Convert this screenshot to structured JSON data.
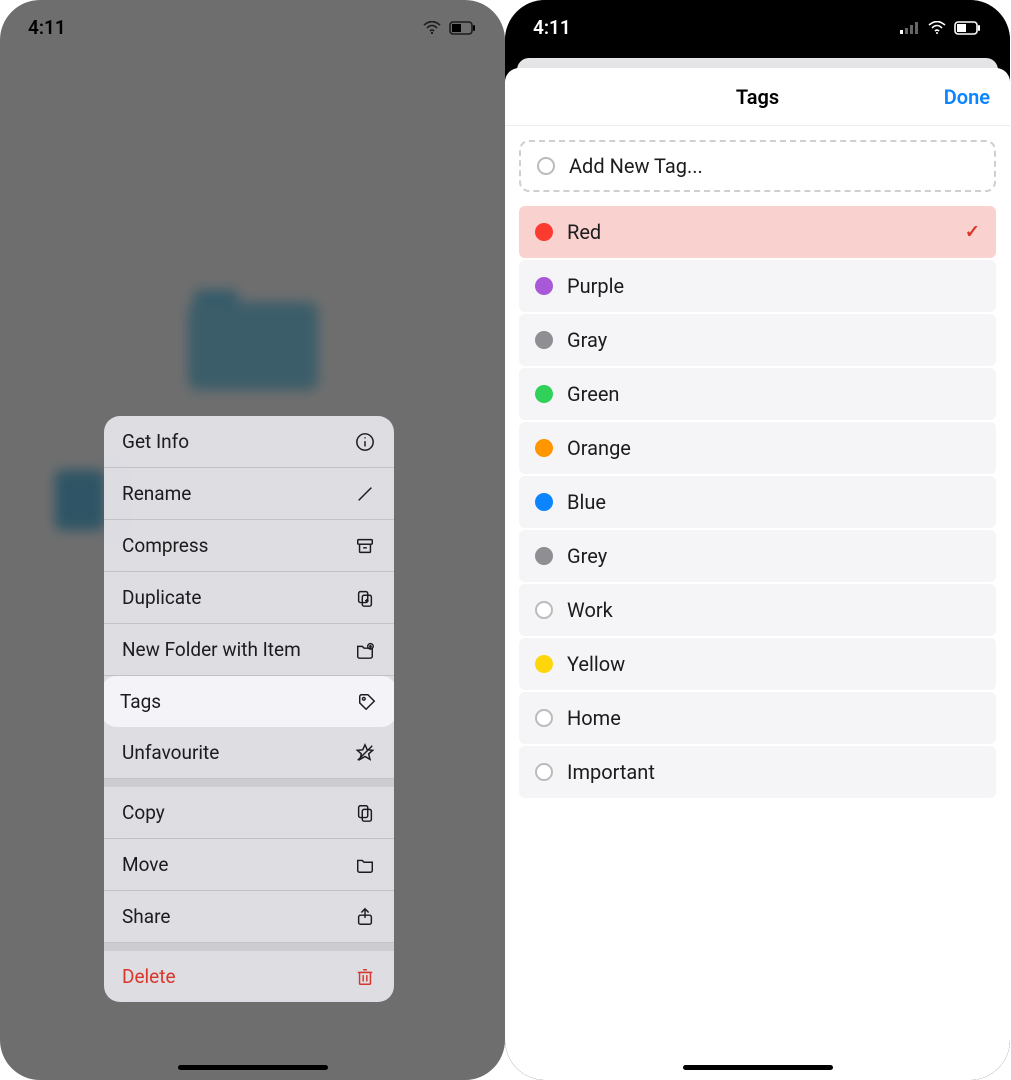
{
  "status": {
    "time": "4:11"
  },
  "context_menu": {
    "items": [
      {
        "label": "Get Info",
        "icon": "info"
      },
      {
        "label": "Rename",
        "icon": "pencil"
      },
      {
        "label": "Compress",
        "icon": "archive"
      },
      {
        "label": "Duplicate",
        "icon": "duplicate"
      },
      {
        "label": "New Folder with Item",
        "icon": "new-folder"
      },
      {
        "label": "Tags",
        "icon": "tag",
        "highlight": true
      },
      {
        "label": "Unfavourite",
        "icon": "star-slash"
      },
      {
        "label": "Copy",
        "icon": "copy"
      },
      {
        "label": "Move",
        "icon": "folder"
      },
      {
        "label": "Share",
        "icon": "share"
      },
      {
        "label": "Delete",
        "icon": "trash",
        "destructive": true
      }
    ]
  },
  "tags_sheet": {
    "title": "Tags",
    "done_label": "Done",
    "add_label": "Add New Tag...",
    "tags": [
      {
        "label": "Red",
        "color": "#fb3b30",
        "selected": true
      },
      {
        "label": "Purple",
        "color": "#a959d8",
        "selected": false
      },
      {
        "label": "Gray",
        "color": "#8e8e93",
        "selected": false
      },
      {
        "label": "Green",
        "color": "#30d158",
        "selected": false
      },
      {
        "label": "Orange",
        "color": "#ff9500",
        "selected": false
      },
      {
        "label": "Blue",
        "color": "#0a84ff",
        "selected": false
      },
      {
        "label": "Grey",
        "color": "#8e8e93",
        "selected": false
      },
      {
        "label": "Work",
        "color": "",
        "selected": false
      },
      {
        "label": "Yellow",
        "color": "#ffd60a",
        "selected": false
      },
      {
        "label": "Home",
        "color": "",
        "selected": false
      },
      {
        "label": "Important",
        "color": "",
        "selected": false
      }
    ]
  }
}
